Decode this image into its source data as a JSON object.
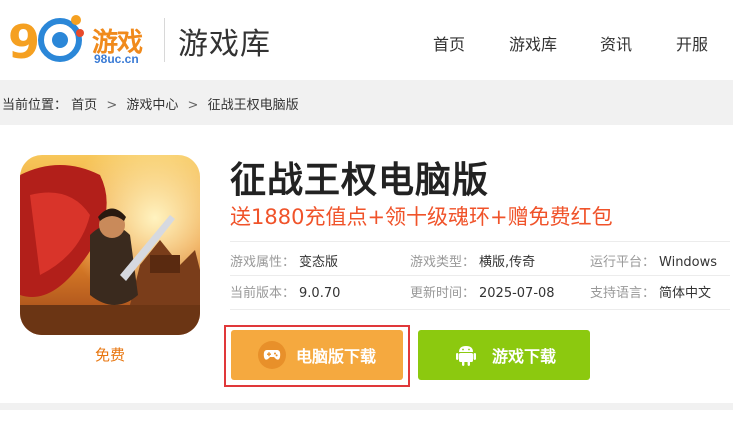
{
  "header": {
    "logo_text": "游戏",
    "logo_sub": "98uc.cn",
    "title": "游戏库",
    "nav": [
      {
        "label": "首页"
      },
      {
        "label": "游戏库"
      },
      {
        "label": "资讯"
      },
      {
        "label": "开服"
      }
    ]
  },
  "breadcrumb": {
    "prefix": "当前位置：",
    "items": [
      "首页",
      "游戏中心",
      "征战王权电脑版"
    ],
    "separator": ">"
  },
  "game": {
    "title": "征战王权电脑版",
    "promo": "送1880充值点+领十级魂环+赠免费红包",
    "price_label": "免费",
    "info": [
      [
        {
          "key": "游戏属性：",
          "value": "变态版"
        },
        {
          "key": "游戏类型：",
          "value": "横版,传奇"
        },
        {
          "key": "运行平台：",
          "value": "Windows"
        }
      ],
      [
        {
          "key": "当前版本：",
          "value": "9.0.70"
        },
        {
          "key": "更新时间：",
          "value": "2025-07-08"
        },
        {
          "key": "支持语言：",
          "value": "简体中文"
        }
      ]
    ]
  },
  "buttons": {
    "pc_download": "电脑版下载",
    "mobile_download": "游戏下载"
  },
  "colors": {
    "accent_orange": "#f5a93f",
    "accent_green": "#8cc90f",
    "promo_red": "#f0532a",
    "highlight_border": "#e0383a"
  }
}
